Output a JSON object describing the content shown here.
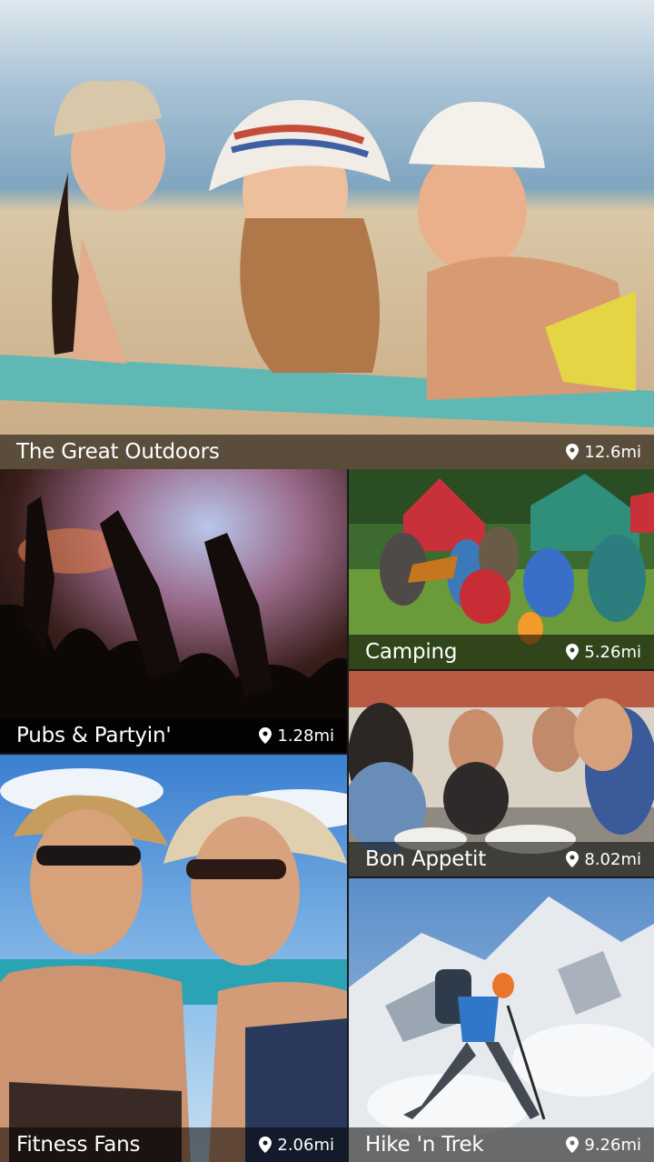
{
  "tiles": [
    {
      "title": "The Great Outdoors",
      "distance": "12.6mi"
    },
    {
      "title": "Pubs & Partyin'",
      "distance": "1.28mi"
    },
    {
      "title": "Camping",
      "distance": "5.26mi"
    },
    {
      "title": "Bon Appetit",
      "distance": "8.02mi"
    },
    {
      "title": "Fitness Fans",
      "distance": "2.06mi"
    },
    {
      "title": "Hike 'n Trek",
      "distance": "9.26mi"
    }
  ],
  "icons": {
    "distance": "location-pin-icon"
  },
  "colors": {
    "caption_bg": "#000000",
    "caption_text": "#ffffff"
  }
}
